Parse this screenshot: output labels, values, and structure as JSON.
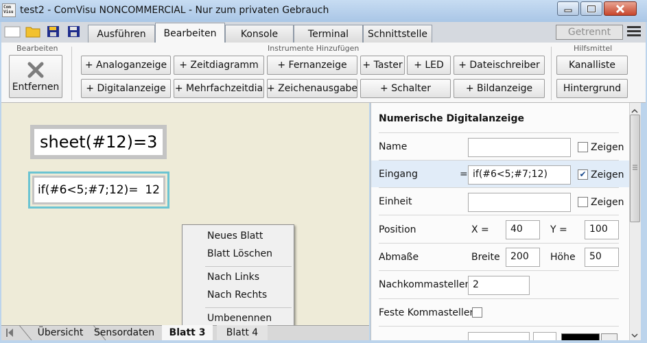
{
  "window": {
    "app_icon_text": "Com\nVisu",
    "title": "test2 - ComVisu NONCOMMERCIAL - Nur zum privaten Gebrauch"
  },
  "tabs": [
    {
      "label": "Ausführen",
      "active": false
    },
    {
      "label": "Bearbeiten",
      "active": true
    },
    {
      "label": "Konsole",
      "active": false
    },
    {
      "label": "Terminal",
      "active": false
    },
    {
      "label": "Schnittstelle",
      "active": false
    }
  ],
  "connection_status": "Getrennt",
  "ribbon": {
    "group_edit": {
      "label": "Bearbeiten",
      "remove_button": "Entfernen"
    },
    "group_instruments": {
      "label": "Instrumente Hinzufügen",
      "buttons_row1": [
        "+ Analoganzeige",
        "+ Zeitdiagramm",
        "+ Fernanzeige",
        "+ Taster",
        "+ LED",
        "+ Dateischreiber"
      ],
      "buttons_row2": [
        "+ Digitalanzeige",
        "+ Mehrfachzeitdia",
        "+ Zeichenausgabe",
        "+ Schalter",
        "+ Bildanzeige"
      ]
    },
    "group_tools": {
      "label": "Hilfsmittel",
      "buttons": [
        "Kanalliste",
        "Hintergrund"
      ]
    }
  },
  "canvas": {
    "widget_sheet": {
      "formula": "sheet(#12)=",
      "value": "3"
    },
    "widget_if": {
      "formula": "if(#6<5;#7;12)=",
      "value": "12"
    }
  },
  "context_menu": {
    "items": [
      "Neues Blatt",
      "Blatt Löschen",
      "Nach Links",
      "Nach Rechts",
      "Umbenennen"
    ]
  },
  "properties": {
    "title": "Numerische Digitalanzeige",
    "name": {
      "label": "Name",
      "value": "",
      "show_label": "Zeigen",
      "show": false
    },
    "eingang": {
      "label": "Eingang",
      "equals": "=",
      "value": "if(#6<5;#7;12)",
      "show_label": "Zeigen",
      "show": true
    },
    "einheit": {
      "label": "Einheit",
      "value": "",
      "show_label": "Zeigen",
      "show": false
    },
    "position": {
      "label": "Position",
      "x_label": "X =",
      "x": "40",
      "y_label": "Y =",
      "y": "100"
    },
    "abmasse": {
      "label": "Abmaße",
      "width_label": "Breite",
      "width": "200",
      "height_label": "Höhe",
      "height": "50"
    },
    "nachkommastellen": {
      "label": "Nachkommastellen",
      "value": "2"
    },
    "feste_kommastellen": {
      "label": "Feste Kommastellen",
      "checked": false
    }
  },
  "sheet_tabs": [
    {
      "label": "Übersicht",
      "active": false
    },
    {
      "label": "Sensordaten",
      "active": false
    },
    {
      "label": "Blatt 3",
      "active": true
    },
    {
      "label": "Blatt 4",
      "active": false
    }
  ]
}
